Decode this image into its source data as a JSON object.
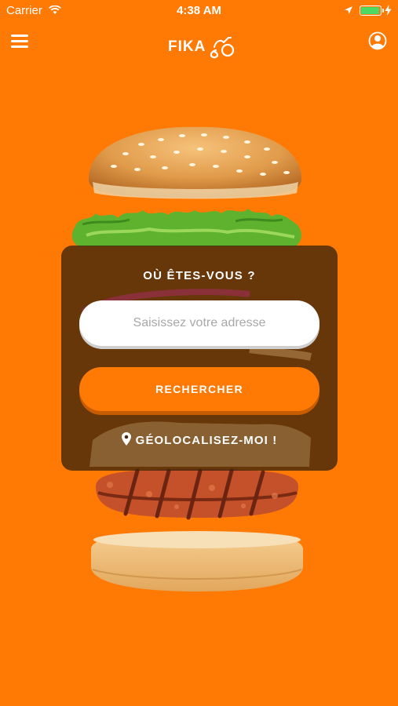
{
  "status_bar": {
    "carrier": "Carrier",
    "time": "4:38 AM",
    "battery_level": 1.0,
    "icons": [
      "wifi-icon",
      "location-arrow-icon",
      "battery-icon",
      "charging-bolt-icon"
    ]
  },
  "navbar": {
    "logo_text": "FIKA",
    "icons": [
      "hamburger-menu-icon",
      "user-account-icon"
    ]
  },
  "search_panel": {
    "question": "OÙ ÊTES-VOUS ?",
    "address_placeholder": "Saisissez votre adresse",
    "search_button_label": "RECHERCHER",
    "geolocate_label": "GÉOLOCALISEZ-MOI !",
    "geolocate_icon": "map-pin-icon"
  },
  "colors": {
    "background": "#ff7a05",
    "panel": "#3c220a",
    "button": "#ff7a05",
    "battery": "#4cd964"
  }
}
